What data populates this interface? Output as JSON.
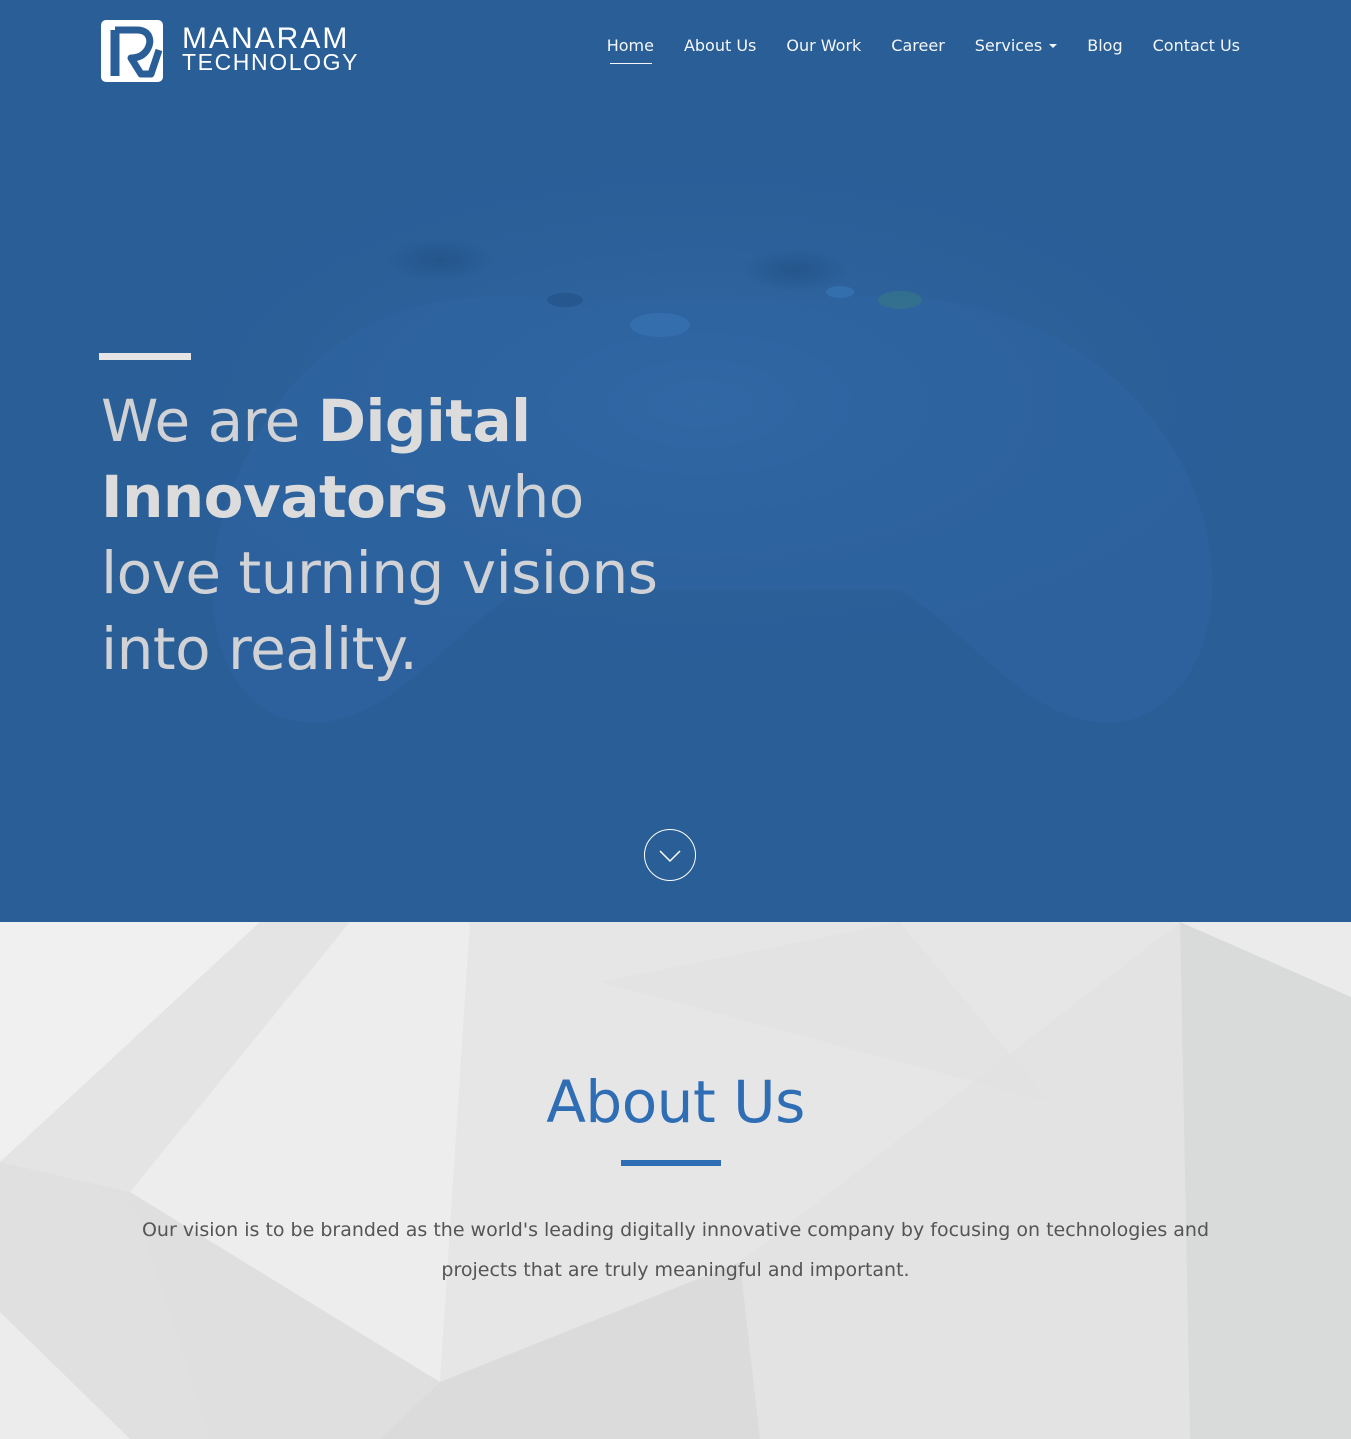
{
  "header": {
    "logo_line1": "MANARAM",
    "logo_line2": "TECHNOLOGY",
    "nav": [
      {
        "label": "Home",
        "active": true
      },
      {
        "label": "About Us"
      },
      {
        "label": "Our Work"
      },
      {
        "label": "Career"
      },
      {
        "label": "Services",
        "has_dropdown": true
      },
      {
        "label": "Blog"
      },
      {
        "label": "Contact Us"
      }
    ]
  },
  "hero": {
    "heading_part1": "We are ",
    "heading_bold": "Digital Innovators",
    "heading_part2": " who love turning visions into reality.",
    "scroll_icon": "chevron-down-icon",
    "background_color": "#2a5e97"
  },
  "about": {
    "title": "About Us",
    "text": "Our vision is to be branded as the world's leading digitally innovative company by focusing on technologies and projects that are truly meaningful and important.",
    "accent_color": "#2f6db5"
  }
}
